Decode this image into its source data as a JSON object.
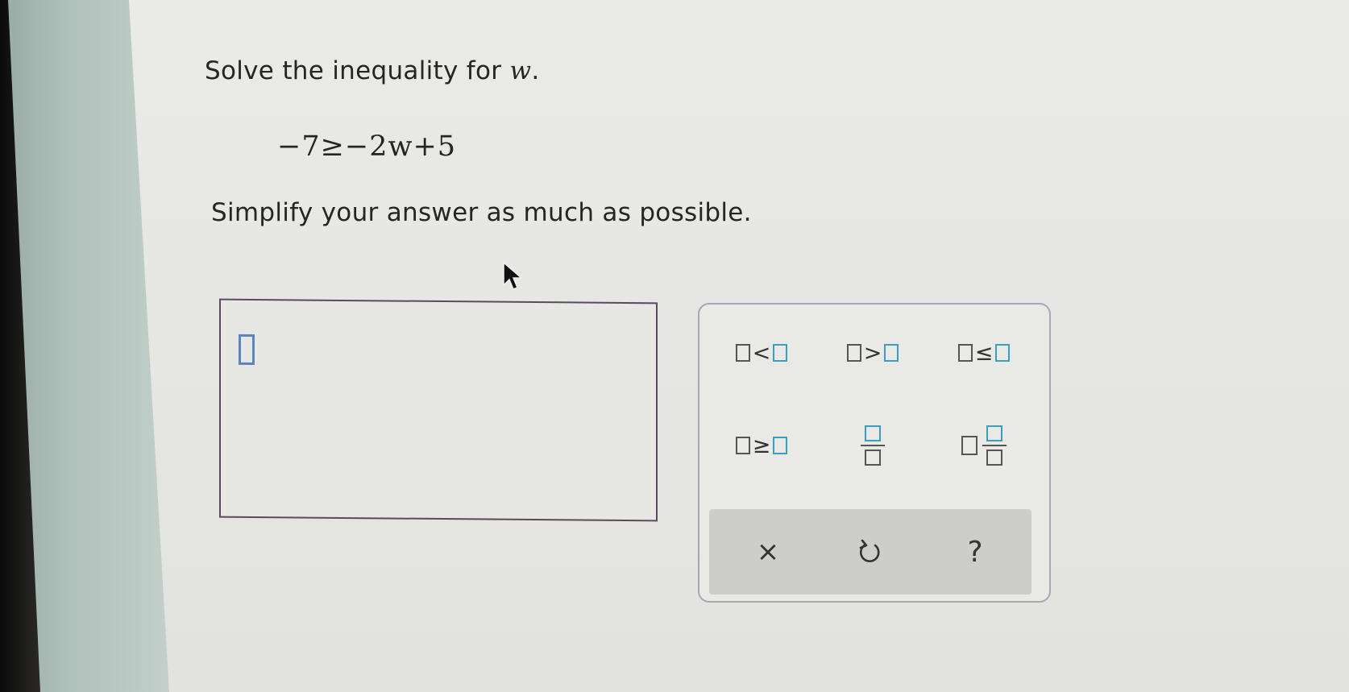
{
  "question": {
    "prompt_prefix": "Solve the inequality for ",
    "prompt_variable": "w",
    "prompt_suffix": ".",
    "equation": "−7≥−2w+5",
    "instruction": "Simplify your answer as much as possible."
  },
  "palette": {
    "buttons": [
      {
        "name": "less-than",
        "symbol": "<"
      },
      {
        "name": "greater-than",
        "symbol": ">"
      },
      {
        "name": "less-than-or-equal",
        "symbol": "≤"
      },
      {
        "name": "greater-than-or-equal",
        "symbol": "≥"
      },
      {
        "name": "fraction"
      },
      {
        "name": "mixed-number"
      }
    ],
    "actions": [
      {
        "name": "clear",
        "symbol": "×"
      },
      {
        "name": "undo",
        "icon": "undo-icon"
      },
      {
        "name": "help",
        "symbol": "?"
      }
    ]
  },
  "colors": {
    "input_caret": "#5a83c0",
    "template_square": "#3b9ec0",
    "answer_border": "#5b4a5e",
    "palette_border": "#a0a9b4"
  }
}
